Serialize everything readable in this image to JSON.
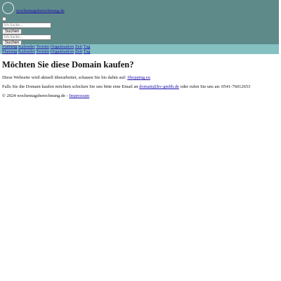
{
  "header": {
    "site_name": "wochentagsberechnung.de",
    "search_bar_1": {
      "placeholder": "Ich Suche...",
      "button": "Suchen"
    },
    "search_bar_2": {
      "placeholder": "Ich Suche...",
      "button": "Suchen"
    }
  },
  "colors": {
    "header_bg": "#5f8a8a",
    "nav_bg": "#85c1c1",
    "link": "#1a0dab"
  },
  "nav": {
    "row1": [
      "Planung",
      "Kalender",
      "Termin",
      "Organisation",
      "Zeit",
      "Tag"
    ],
    "row2": [
      "Planung",
      "Kalender",
      "Termin",
      "Organisation",
      "Zeit",
      "Tag"
    ]
  },
  "main": {
    "heading": "Möchten Sie diese Domain kaufen?",
    "p1_text": "Diese Webseite wird aktuell überarbeitet, schauen Sie bis dahin auf:",
    "p1_link": "Shopping.eu",
    "p2_text_a": "Falls Sie die Domain kaufen möchten schicken Sie uns bitte eine Email an",
    "p2_email": "domain@kv-gmbh.de",
    "p2_text_b": "oder rufen Sie uns an: 0541-76012653"
  },
  "footer": {
    "copyright": "© 2024 wochentagsberechnung.de -",
    "impressum": "Impressum"
  }
}
